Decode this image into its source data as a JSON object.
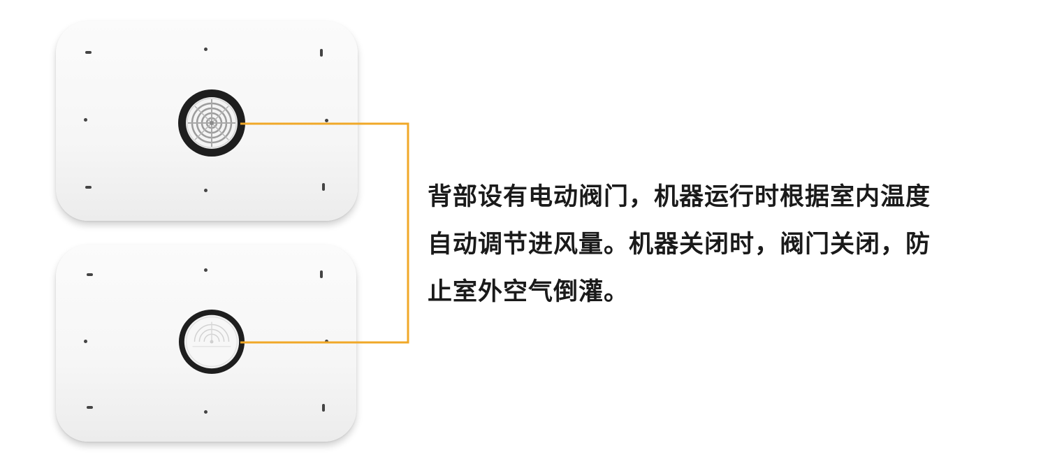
{
  "description": {
    "line1": "背部设有电动阀门，机器运行时根据室内温度",
    "line2": "自动调节进风量。机器关闭时，阀门关闭，防",
    "line3": "止室外空气倒灌。"
  },
  "panels": [
    {
      "name": "back-panel-valve-open",
      "valve_state": "open"
    },
    {
      "name": "back-panel-valve-closed",
      "valve_state": "closed"
    }
  ],
  "colors": {
    "accent_line": "#f0a828",
    "text": "#1a1a1a",
    "panel": "#f7f7f7",
    "valve_ring": "#1e1e1e"
  }
}
